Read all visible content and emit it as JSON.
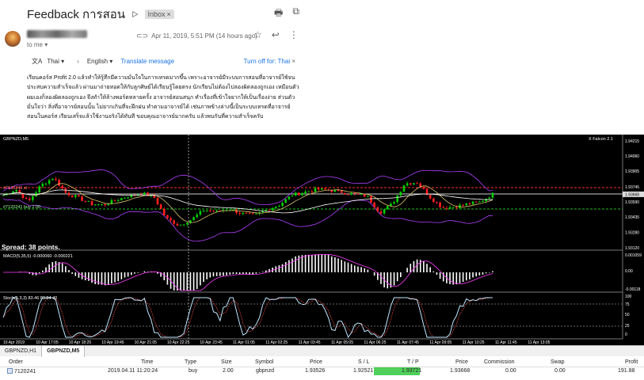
{
  "email": {
    "subject": "Feedback การสอน",
    "inbox_label": "Inbox",
    "inbox_close": "×",
    "to": "to me",
    "date": "Apr 11, 2019, 5:51 PM (14 hours ago)",
    "translate": {
      "source_lang": "Thai",
      "target_lang": "English",
      "translate_link": "Translate message",
      "turn_off": "Turn off for: Thai",
      "close": "×"
    },
    "body": "เรียนคอร์ส Profit 2.0 แล้วทำให้รู้สึกมีความมั่นใจในการเทรดมากขึ้น เพราะอาจารย์มีระบบการสอนที่อาจารย์ใช้จนประสบความสำเร็จแล้ว ผ่านมาถ่ายทอดให้กับลูกศิษย์ได้เรียนรู้โดยตรง นักเรียนไม่ต้องไปลองผิดลองถูกเอง เหมือนตัวผมเองก็ลองผิดลองถูกเอง จึงทำให้ล้างพอร์ตหลายครั้ง อาจารย์สอนสนุก ทำเรื่องที่เข้าใจยากให้เป็นเรื่องง่าย ส่วนตัวมั่นใจว่า สิ่งที่อาจารย์สอนนั้น ไม่ยากเกินที่จะฝึกฝน ทำตามอาจารย์ได้ เช่นภาพข้างล่างนี้เป็นระบบเทรดที่อาจารย์สอนในคอร์ส เรียนเสร็จแล้วใช้งานจริงได้ทันที ขอบคุณอาจารย์มากครับ แล้วพบกันที่ความสำเร็จครับ"
  },
  "chart": {
    "symbol_title": "GBPNZD,M5",
    "indicator_name": "X Falcon 2.1",
    "spread_text": "Spread: 38 points.",
    "order_label_sl": "#7120241 sl",
    "order_label_buy": "#7120241 buy 2.00",
    "price_ticks": [
      "1.94215",
      "1.94060",
      "1.93905",
      "1.93745",
      "1.93668",
      "1.93590",
      "1.93435",
      "1.93280",
      "1.93120"
    ],
    "macd_label": "MACD(5,35,5) -0.000060 -0.000221",
    "macd_ticks": [
      "0.001059",
      "0.00",
      "-0.00118"
    ],
    "stoch_label": "Stoch(5,3,3) 83.46 83.84 40",
    "stoch_ticks": [
      "100",
      "75",
      "50",
      "25",
      "0"
    ],
    "time_labels": [
      "10 Apr 2019",
      "10 Apr 17:05",
      "10 Apr 18:25",
      "10 Apr 19:45",
      "10 Apr 21:05",
      "10 Apr 22:25",
      "10 Apr 23:45",
      "11 Apr 01:05",
      "11 Apr 02:25",
      "11 Apr 03:45",
      "11 Apr 05:05",
      "11 Apr 06:25",
      "11 Apr 07:45",
      "11 Apr 09:05",
      "11 Apr 10:25",
      "11 Apr 11:45",
      "11 Apr 13:05"
    ],
    "colors": {
      "bull": "#00d000",
      "bear": "#ff2020",
      "bands": "#b040ff",
      "ma": "#d9c26a",
      "stoch": "#bfe7ff",
      "macd": "#ffffff",
      "signal": "#ff40ff"
    }
  },
  "tabs": [
    "GBPNZD,H1",
    "GBPNZD,M5"
  ],
  "orders": {
    "headers": [
      "Order",
      "Time",
      "Type",
      "Size",
      "Symbol",
      "Price",
      "S / L",
      "T / P",
      "Price",
      "Commission",
      "Swap",
      "Profit"
    ],
    "rows": [
      [
        "7120241",
        "2019.04.11 11:20:24",
        "buy",
        "2.00",
        "gbpnzd",
        "1.93526",
        "1.92521",
        "1.93721",
        "1.93668",
        "0.00",
        "0.00",
        "191.88"
      ]
    ]
  },
  "chart_data": {
    "type": "candlestick",
    "symbol": "GBPNZD",
    "timeframe": "M5",
    "price_axis_ticks": [
      1.94215,
      1.9406,
      1.93905,
      1.93745,
      1.93668,
      1.9359,
      1.93435,
      1.9328,
      1.9312
    ],
    "current_price": 1.93668,
    "order_levels": {
      "entry": 1.93526,
      "take_profit": 1.93721,
      "stop_loss": 1.92521
    },
    "macd": {
      "params": "5,35,5",
      "main": -6e-05,
      "signal": -0.000221,
      "axis": [
        0.001059,
        0,
        -0.00118
      ]
    },
    "stochastic": {
      "params": "5,3,3",
      "main": 83.46,
      "signal": 83.84,
      "axis": [
        100,
        75,
        50,
        25,
        0
      ]
    },
    "time_axis": [
      "10 Apr 2019",
      "10 Apr 17:05",
      "10 Apr 18:25",
      "10 Apr 19:45",
      "10 Apr 21:05",
      "10 Apr 22:25",
      "10 Apr 23:45",
      "11 Apr 01:05",
      "11 Apr 02:25",
      "11 Apr 03:45",
      "11 Apr 05:05",
      "11 Apr 06:25",
      "11 Apr 07:45",
      "11 Apr 09:05",
      "11 Apr 10:25",
      "11 Apr 11:45",
      "11 Apr 13:05"
    ],
    "close_profile": [
      1.9366,
      1.9372,
      1.9359,
      1.9376,
      1.9384,
      1.9368,
      1.9363,
      1.9357,
      1.9356,
      1.9361,
      1.9365,
      1.9368,
      1.9364,
      1.9342,
      1.9335,
      1.9341,
      1.9351,
      1.9349,
      1.9352,
      1.9347,
      1.9345,
      1.9351,
      1.9356,
      1.9366,
      1.9369,
      1.9372,
      1.9371,
      1.9369,
      1.9367,
      1.9365,
      1.9348,
      1.9357,
      1.9378,
      1.9379,
      1.9364,
      1.9353,
      1.9354,
      1.9357,
      1.9359,
      1.9367
    ]
  }
}
